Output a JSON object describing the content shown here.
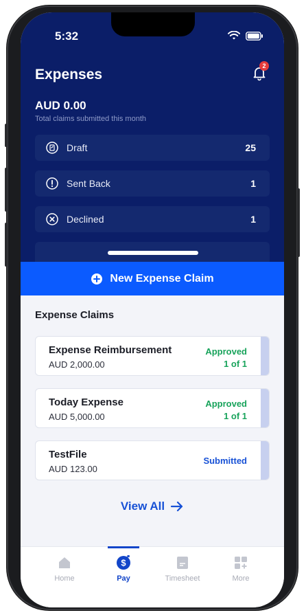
{
  "status_bar": {
    "time": "5:32"
  },
  "header": {
    "title": "Expenses",
    "notification_count": "2",
    "total_amount": "AUD 0.00",
    "total_caption": "Total claims submitted this month"
  },
  "summary": [
    {
      "label": "Draft",
      "count": "25",
      "icon": "draft-icon"
    },
    {
      "label": "Sent Back",
      "count": "1",
      "icon": "alert-circle-icon"
    },
    {
      "label": "Declined",
      "count": "1",
      "icon": "x-circle-icon"
    }
  ],
  "new_claim_button": {
    "label": "New Expense Claim"
  },
  "claims_section": {
    "title": "Expense Claims",
    "items": [
      {
        "name": "Expense Reimbursement",
        "amount": "AUD 2,000.00",
        "status": "Approved",
        "step": "1 of 1"
      },
      {
        "name": "Today Expense",
        "amount": "AUD 5,000.00",
        "status": "Approved",
        "step": "1 of 1"
      },
      {
        "name": "TestFile",
        "amount": "AUD 123.00",
        "status": "Submitted",
        "step": ""
      }
    ],
    "view_all_label": "View All"
  },
  "tabs": [
    {
      "label": "Home",
      "icon": "home-icon"
    },
    {
      "label": "Pay",
      "icon": "pay-icon"
    },
    {
      "label": "Timesheet",
      "icon": "timesheet-icon"
    },
    {
      "label": "More",
      "icon": "grid-plus-icon"
    }
  ],
  "colors": {
    "header_bg": "#0b1e68",
    "primary": "#0b5bff",
    "approved": "#18a35b",
    "submitted": "#1751d6",
    "badge": "#e53b3b"
  }
}
